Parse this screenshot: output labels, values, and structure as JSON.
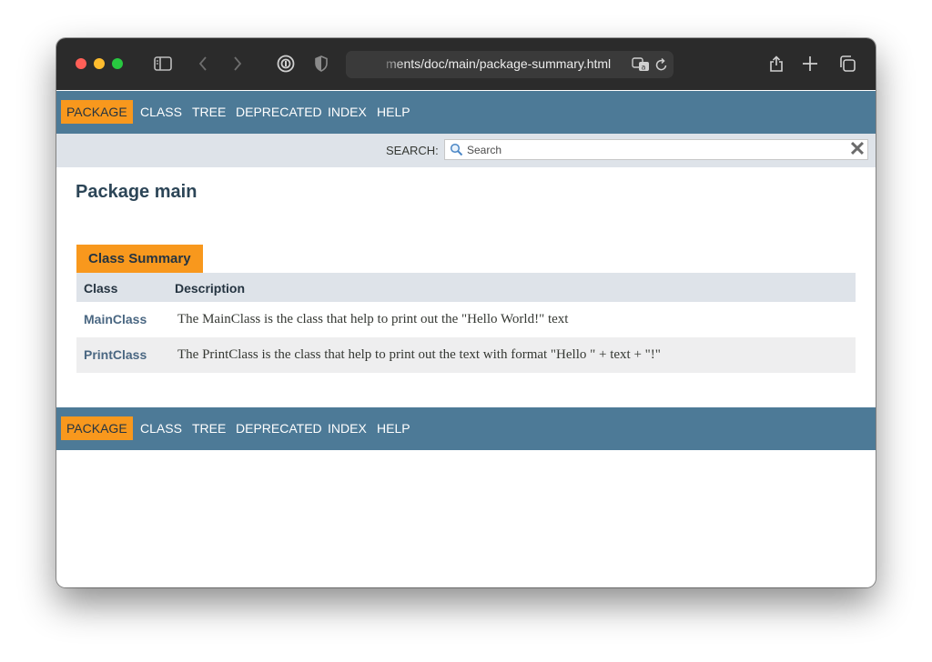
{
  "browser": {
    "url": "ments/doc/main/package-summary.html"
  },
  "nav": {
    "items": [
      "PACKAGE",
      "CLASS",
      "TREE",
      "DEPRECATED",
      "INDEX",
      "HELP"
    ]
  },
  "search": {
    "label": "SEARCH:",
    "placeholder": "Search",
    "reset_glyph": "✕"
  },
  "page": {
    "title": "Package main"
  },
  "class_summary": {
    "caption": "Class Summary",
    "headers": [
      "Class",
      "Description"
    ],
    "rows": [
      {
        "name": "MainClass",
        "description": "The MainClass is the class that help to print out the \"Hello World!\" text"
      },
      {
        "name": "PrintClass",
        "description": "The PrintClass is the class that help to print out the text with format \"Hello \" + text + \"!\""
      }
    ]
  },
  "colors": {
    "nav_bar": "#4d7a97",
    "active_tab": "#f8981d",
    "sub_bar": "#dee3e9",
    "title_bar": "#2b2b2b"
  },
  "icons": [
    "sidebar-icon",
    "back-icon",
    "forward-icon",
    "password-icon",
    "shield-icon",
    "translate-icon",
    "reload-icon",
    "share-icon",
    "new-tab-icon",
    "tabs-overview-icon",
    "search-icon",
    "close-icon"
  ]
}
